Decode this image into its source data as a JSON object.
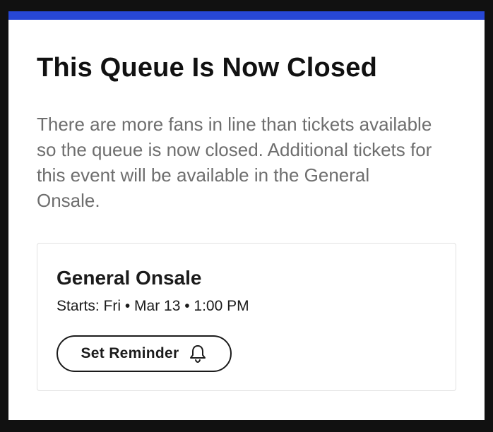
{
  "modal": {
    "title": "This Queue Is Now Closed",
    "description": "There are more fans in line than tickets available so the queue is now closed. Additional tickets for this event will be available in the General Onsale."
  },
  "onsale_card": {
    "title": "General Onsale",
    "starts": "Starts: Fri • Mar 13 • 1:00 PM",
    "reminder_button_label": "Set Reminder",
    "reminder_icon": "bell-icon"
  },
  "colors": {
    "accent_bar": "#2747d6",
    "background": "#ffffff",
    "text_primary": "#111111",
    "text_secondary": "#6e6e6e",
    "card_border": "#e1e1e1"
  }
}
